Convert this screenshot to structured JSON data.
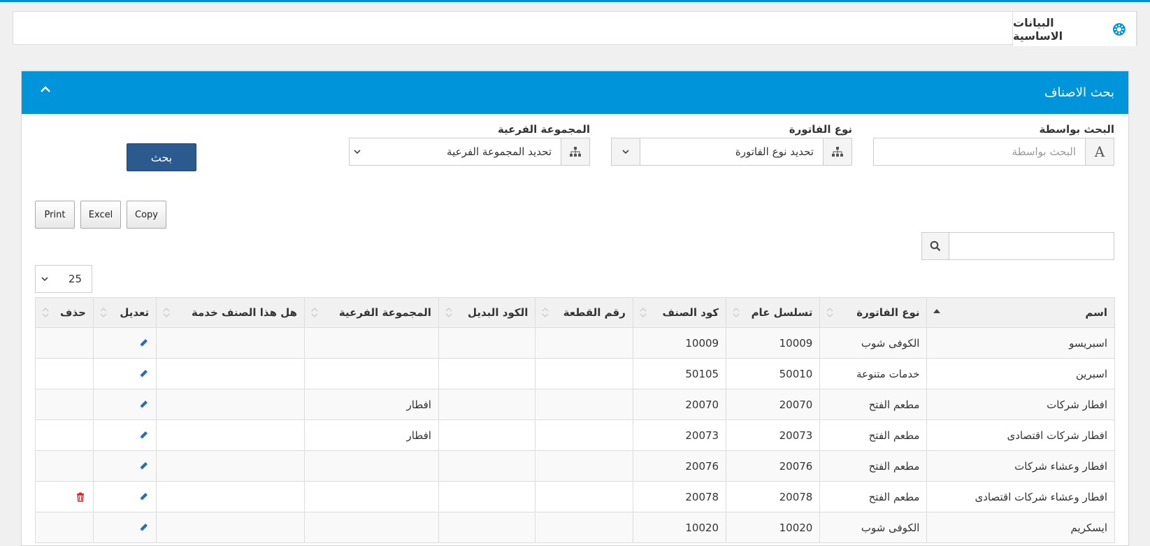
{
  "tabs": [
    {
      "label": "البيانات الاساسية",
      "icon": "gear-icon"
    }
  ],
  "panel": {
    "title": "بحث الاصناف",
    "collapse_icon": "chevron-up-icon"
  },
  "form": {
    "search_by": {
      "label": "البحث بواسطة",
      "placeholder": "البحث بواسطة",
      "icon": "text-a-icon"
    },
    "invoice_type": {
      "label": "نوع الفاتورة",
      "value": "تحديد نوع الفاتورة",
      "icon": "sitemap-icon"
    },
    "subgroup": {
      "label": "المجموعة الفرعية",
      "value": "تحديد المجموعة الفرعية",
      "icon": "sitemap-icon"
    },
    "search_button": "بحث"
  },
  "export": {
    "copy": "Copy",
    "excel": "Excel",
    "print": "Print"
  },
  "filter": {
    "value": "",
    "icon": "search-icon"
  },
  "page_size": {
    "value": "25"
  },
  "table": {
    "columns": [
      "اسم",
      "نوع الفاتورة",
      "تسلسل عام",
      "كود الصنف",
      "رقم القطعة",
      "الكود البديل",
      "المجموعة الفرعية",
      "هل هذا الصنف خدمة",
      "تعديل",
      "حذف"
    ],
    "rows": [
      {
        "name": "اسبريسو",
        "invoice_type": "الكوفى شوب",
        "serial": "10009",
        "code": "10009",
        "part": "",
        "alt": "",
        "subgroup": "",
        "service": "",
        "delete": false
      },
      {
        "name": "اسبرين",
        "invoice_type": "خدمات متنوعة",
        "serial": "50010",
        "code": "50105",
        "part": "",
        "alt": "",
        "subgroup": "",
        "service": "",
        "delete": false
      },
      {
        "name": "افطار شركات",
        "invoice_type": "مطعم الفتح",
        "serial": "20070",
        "code": "20070",
        "part": "",
        "alt": "",
        "subgroup": "افطار",
        "service": "",
        "delete": false
      },
      {
        "name": "افطار شركات اقتصادى",
        "invoice_type": "مطعم الفتح",
        "serial": "20073",
        "code": "20073",
        "part": "",
        "alt": "",
        "subgroup": "افطار",
        "service": "",
        "delete": false
      },
      {
        "name": "افطار وعشاء شركات",
        "invoice_type": "مطعم الفتح",
        "serial": "20076",
        "code": "20076",
        "part": "",
        "alt": "",
        "subgroup": "",
        "service": "",
        "delete": false
      },
      {
        "name": "افطار وعشاء شركات اقتصادى",
        "invoice_type": "مطعم الفتح",
        "serial": "20078",
        "code": "20078",
        "part": "",
        "alt": "",
        "subgroup": "",
        "service": "",
        "delete": true
      },
      {
        "name": "ايسكريم",
        "invoice_type": "الكوفى شوب",
        "serial": "10020",
        "code": "10020",
        "part": "",
        "alt": "",
        "subgroup": "",
        "service": "",
        "delete": false
      }
    ]
  },
  "colors": {
    "accent": "#0095db",
    "button": "#2a5a8e",
    "pencil": "#2a6db5",
    "trash": "#e02020"
  }
}
